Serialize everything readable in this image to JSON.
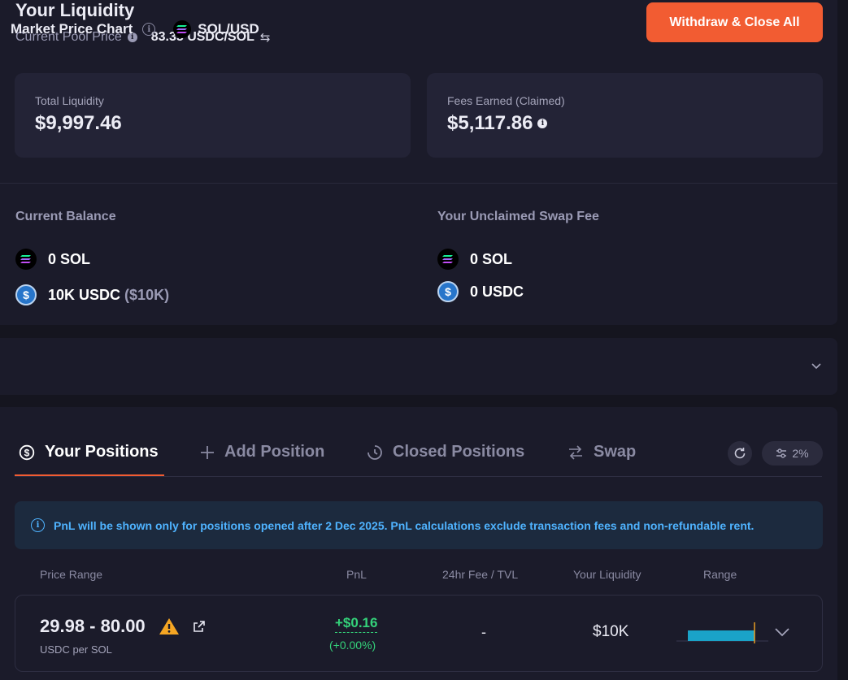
{
  "liquidity": {
    "title": "Your Liquidity",
    "pool_price_label": "Current Pool Price",
    "pool_price_value": "83.35 USDC/SOL",
    "withdraw_label": "Withdraw & Close All",
    "total_liquidity_label": "Total Liquidity",
    "total_liquidity_value": "$9,997.46",
    "fees_label": "Fees Earned (Claimed)",
    "fees_value": "$5,117.86"
  },
  "balance": {
    "current_heading": "Current Balance",
    "current_sol": "0 SOL",
    "current_usdc": "10K USDC",
    "current_usdc_usd": "($10K)",
    "unclaimed_heading": "Your Unclaimed Swap Fee",
    "unclaimed_sol": "0 SOL",
    "unclaimed_usdc": "0 USDC"
  },
  "chart": {
    "title": "Market Price Chart",
    "pair": "SOL/USD"
  },
  "tabs": [
    {
      "label": "Your Positions",
      "icon": "dollar-circle-icon"
    },
    {
      "label": "Add Position",
      "icon": "plus-icon"
    },
    {
      "label": "Closed Positions",
      "icon": "clock-icon"
    },
    {
      "label": "Swap",
      "icon": "swap-arrows-icon"
    }
  ],
  "slippage": "2%",
  "notice": "PnL will be shown only for positions opened after 2 Dec 2025. PnL calculations exclude transaction fees and non-refundable rent.",
  "table": {
    "headers": [
      "Price Range",
      "PnL",
      "24hr Fee / TVL",
      "Your Liquidity",
      "Range"
    ],
    "row": {
      "range": "29.98 - 80.00",
      "unit": "USDC per SOL",
      "pnl": "+$0.16",
      "pnl_pct": "(+0.00%)",
      "fee_tvl": "-",
      "liquidity": "$10K"
    }
  },
  "colors": {
    "accent": "#f25c32",
    "positive": "#34d27a",
    "info": "#4fb3ff",
    "range_bar": "#1aa3c8",
    "warning": "#f5a623"
  }
}
